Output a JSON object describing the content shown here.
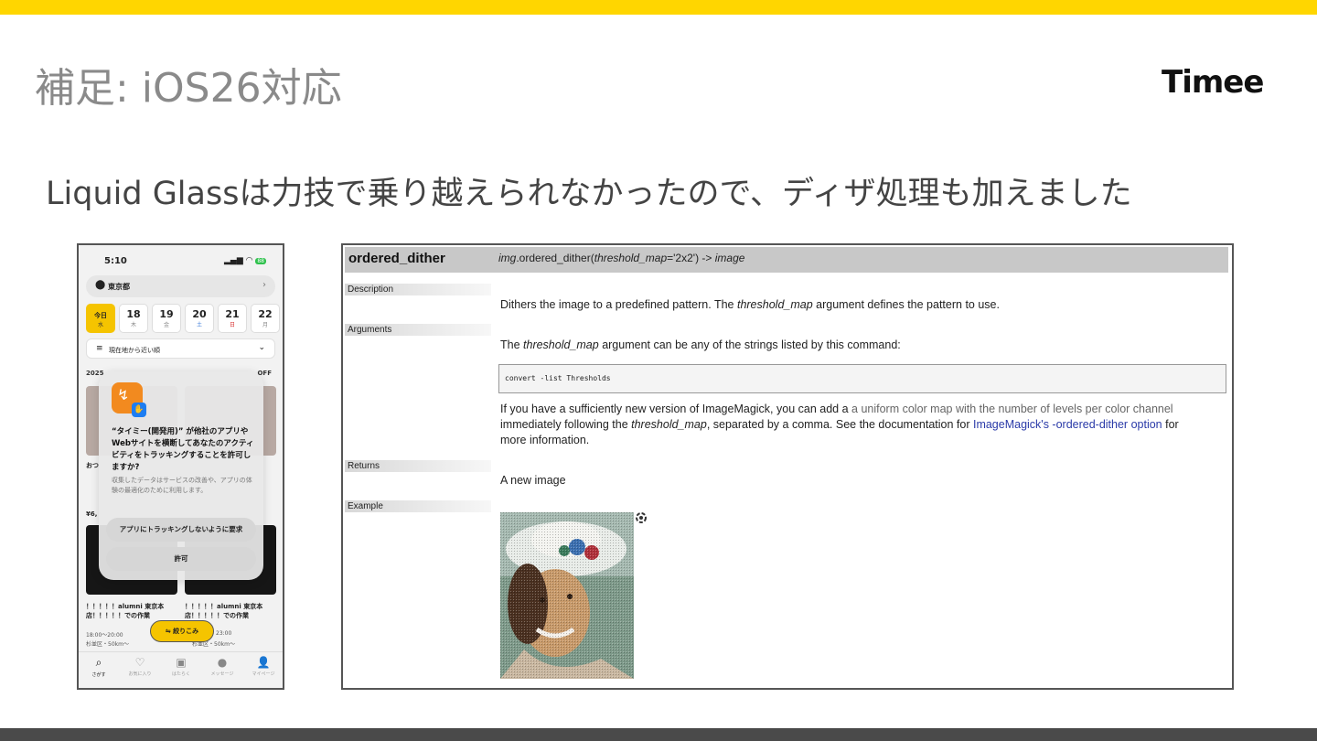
{
  "slide": {
    "title": "補足: iOS26対応",
    "logo": "Timee",
    "subtitle": "Liquid Glassは力技で乗り越えられなかったので、ディザ処理も加えました"
  },
  "phone": {
    "time": "5:10",
    "battery": "88",
    "location": "東京都",
    "dates": [
      {
        "n": "今日",
        "d": "水",
        "active": true
      },
      {
        "n": "18",
        "d": "木"
      },
      {
        "n": "19",
        "d": "金"
      },
      {
        "n": "20",
        "d": "土"
      },
      {
        "n": "21",
        "d": "日"
      },
      {
        "n": "22",
        "d": "月"
      }
    ],
    "sort_label": "現在地から近い順",
    "bg_header": "2025",
    "bg_off": "OFF",
    "bg_text_1": "おつ",
    "bg_price": "¥6,",
    "card_title_1": "！！！！！alumni 東京本店！！！！！での作業",
    "card_title_2": "！！！！！alumni 東京本店！！！！！での作業",
    "card_time_1": "18:00～20:00",
    "card_time_2": "23:00",
    "card_place_1": "杉並区・50km～",
    "card_place_2": "杉並区・50km～",
    "dialog": {
      "title": "“タイミー(開発用)” が他社のアプリやWebサイトを横断してあなたのアクティビティをトラッキングすることを許可しますか?",
      "body": "収集したデータはサービスの改善や、アプリの体験の最適化のために利用します。",
      "deny": "アプリにトラッキングしないように要求",
      "allow": "許可"
    },
    "filter": "絞りこみ",
    "tabs": [
      "さがす",
      "お気に入り",
      "はたらく",
      "メッセージ",
      "マイページ"
    ]
  },
  "doc": {
    "name": "ordered_dither",
    "signature_obj": "img",
    "signature_fn": ".ordered_dither(",
    "signature_arg": "threshold_map",
    "signature_val": "='2x2') -> ",
    "signature_ret": "image",
    "labels": {
      "description": "Description",
      "arguments": "Arguments",
      "returns": "Returns",
      "example": "Example"
    },
    "description_1": "Dithers the image to a predefined pattern. The ",
    "description_em": "threshold_map",
    "description_2": " argument defines the pattern to use.",
    "args_1": "The ",
    "args_em": "threshold_map",
    "args_2": " argument can be any of the strings listed by this command:",
    "code": "convert -list Thresholds",
    "p1_a": "If you have a sufficiently new version of ImageMagick, you can add a ",
    "p1_muted": "a uniform color map with the number of levels per color channel",
    "p2_a": "immediately following the ",
    "p2_em": "threshold_map",
    "p2_b": ", separated by a comma. See the documentation for ",
    "p2_link": "ImageMagick's -ordered-dither option",
    "p2_c": " for",
    "p3": "more information.",
    "returns": "A new image"
  },
  "colors": {
    "accent": "#ffd600",
    "link": "#2a3aa8",
    "bottom": "#4a4a4a"
  }
}
